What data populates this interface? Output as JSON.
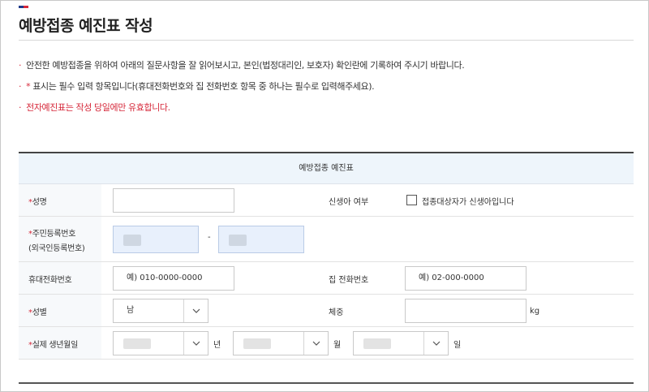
{
  "page": {
    "title": "예방접종 예진표 작성"
  },
  "notices": [
    {
      "dot": "·",
      "text": "안전한 예방접종을 위하여 아래의 질문사항을 잘 읽어보시고, 본인(법정대리인, 보호자) 확인란에 기록하여 주시기 바랍니다."
    },
    {
      "dot": "·",
      "star": "*",
      "text": " 표시는 필수 입력 항목입니다(휴대전화번호와 집 전화번호 항목 중 하나는 필수로 입력해주세요)."
    },
    {
      "dot": "·",
      "text": "전자예진표는 작성 당일에만 유효합니다."
    }
  ],
  "form": {
    "caption": "예방접종 예진표",
    "required_mark": "*",
    "name_label": "성명",
    "name_value": "",
    "newborn_label": "신생아 여부",
    "newborn_checkbox_label": "접종대상자가 신생아입니다",
    "rrn_label_line1": "주민등록번호",
    "rrn_label_line2": "(외국인등록번호)",
    "rrn_separator": "-",
    "mobile_label": "휴대전화번호",
    "mobile_value": "예) 010-0000-0000",
    "home_phone_label": "집 전화번호",
    "home_phone_value": "예) 02-000-0000",
    "gender_label": "성별",
    "gender_value": "남",
    "weight_label": "체중",
    "weight_unit": "kg",
    "birth_label": "실제 생년월일",
    "year_unit": "년",
    "month_unit": "월",
    "day_unit": "일"
  },
  "colors": {
    "accent_red": "#d6283a",
    "caption_bg": "#eef5fb",
    "masked_field_bg": "#e8f0fc"
  },
  "icons": {
    "dropdown": "chevron-down-icon",
    "flag": "flag-icon"
  }
}
